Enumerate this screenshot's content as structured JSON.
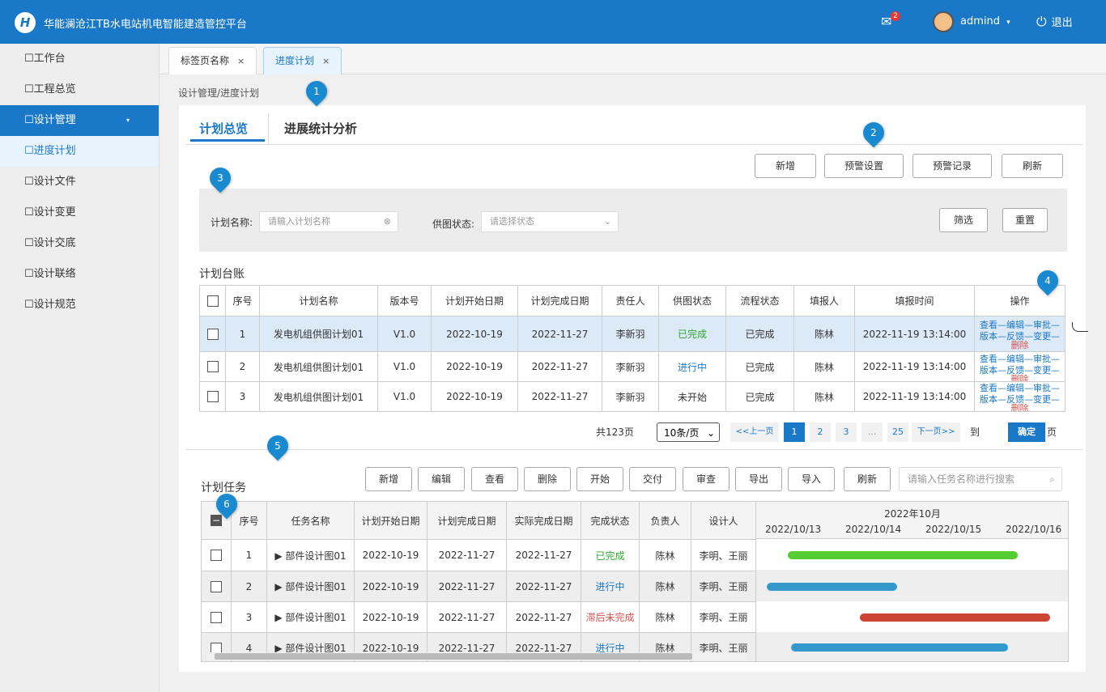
{
  "header": {
    "logo_letter": "H",
    "title": "华能澜沧江TB水电站机电智能建造管控平台",
    "notify_count": "2",
    "user": "admind",
    "user_caret": "▾",
    "logout": "退出"
  },
  "sidebar": {
    "items": [
      {
        "label": "工作台"
      },
      {
        "label": "工程总览"
      },
      {
        "label": "设计管理",
        "caret": "▾"
      },
      {
        "label": "进度计划"
      },
      {
        "label": "设计文件"
      },
      {
        "label": "设计变更"
      },
      {
        "label": "设计交底"
      },
      {
        "label": "设计联络"
      },
      {
        "label": "设计规范"
      }
    ]
  },
  "tabs": [
    {
      "label": "标签页名称"
    },
    {
      "label": "进度计划"
    }
  ],
  "tab_close": "×",
  "breadcrumb": "设计管理/进度计划",
  "page_tabs": [
    "计划总览",
    "进展统计分析"
  ],
  "top_buttons": [
    "新增",
    "预警设置",
    "预警记录",
    "刷新"
  ],
  "filter": {
    "name_label": "计划名称:",
    "name_placeholder": "请输入计划名称",
    "status_label": "供图状态:",
    "status_placeholder": "请选择状态",
    "search": "筛选",
    "reset": "重置"
  },
  "ledger": {
    "title": "计划台账",
    "headers": [
      "序号",
      "计划名称",
      "版本号",
      "计划开始日期",
      "计划完成日期",
      "责任人",
      "供图状态",
      "流程状态",
      "填报人",
      "填报时间",
      "操作"
    ],
    "rows": [
      {
        "no": "1",
        "name": "发电机组供图计划01",
        "ver": "V1.0",
        "start": "2022-10-19",
        "end": "2022-11-27",
        "owner": "李新羽",
        "status": "已完成",
        "flow": "已完成",
        "reporter": "陈林",
        "time": "2022-11-19 13:14:00"
      },
      {
        "no": "2",
        "name": "发电机组供图计划01",
        "ver": "V1.0",
        "start": "2022-10-19",
        "end": "2022-11-27",
        "owner": "李新羽",
        "status": "进行中",
        "flow": "已完成",
        "reporter": "陈林",
        "time": "2022-11-19 13:14:00"
      },
      {
        "no": "3",
        "name": "发电机组供图计划01",
        "ver": "V1.0",
        "start": "2022-10-19",
        "end": "2022-11-27",
        "owner": "李新羽",
        "status": "未开始",
        "flow": "已完成",
        "reporter": "陈林",
        "time": "2022-11-19 13:14:00"
      }
    ],
    "ops_line1": "查看—编辑—审批—",
    "ops_line2": "版本—反馈—变更—",
    "ops_del": "删除"
  },
  "pagination": {
    "total": "共123页",
    "size": "10条/页",
    "prev": "<<上一页",
    "pages": [
      "1",
      "2",
      "3",
      "...",
      "25"
    ],
    "next": "下一页>>",
    "goto": "到",
    "confirm": "确定",
    "unit": "页"
  },
  "tasks": {
    "title": "计划任务",
    "buttons": [
      "新增",
      "编辑",
      "查看",
      "删除",
      "开始",
      "交付",
      "审查",
      "导出",
      "导入",
      "刷新"
    ],
    "search_placeholder": "请输入任务名称进行搜索",
    "headers": [
      "序号",
      "任务名称",
      "计划开始日期",
      "计划完成日期",
      "实际完成日期",
      "完成状态",
      "负责人",
      "设计人"
    ],
    "gantt_month": "2022年10月",
    "gantt_days": [
      "2022/10/13",
      "2022/10/14",
      "2022/10/15",
      "2022/10/16"
    ],
    "rows": [
      {
        "no": "1",
        "name": "部件设计图01",
        "start": "2022-10-19",
        "end": "2022-11-27",
        "actual": "2022-11-27",
        "status": "已完成",
        "owner": "陈林",
        "designer": "李明、王丽"
      },
      {
        "no": "2",
        "name": "部件设计图01",
        "start": "2022-10-19",
        "end": "2022-11-27",
        "actual": "2022-11-27",
        "status": "进行中",
        "owner": "陈林",
        "designer": "李明、王丽"
      },
      {
        "no": "3",
        "name": "部件设计图01",
        "start": "2022-10-19",
        "end": "2022-11-27",
        "actual": "2022-11-27",
        "status": "滞后未完成",
        "owner": "陈林",
        "designer": "李明、王丽"
      },
      {
        "no": "4",
        "name": "部件设计图01",
        "start": "2022-10-19",
        "end": "2022-11-27",
        "actual": "2022-11-27",
        "status": "进行中",
        "owner": "陈林",
        "designer": "李明、王丽"
      }
    ]
  },
  "markers": [
    "1",
    "2",
    "3",
    "4",
    "5",
    "6"
  ],
  "colors": {
    "primary": "#1a78c8",
    "done": "#2ea82e",
    "progress": "#1a78c8",
    "late": "#d9534f",
    "bar_green": "#55cc33",
    "bar_blue": "#3399cc",
    "bar_red": "#cc4433"
  }
}
